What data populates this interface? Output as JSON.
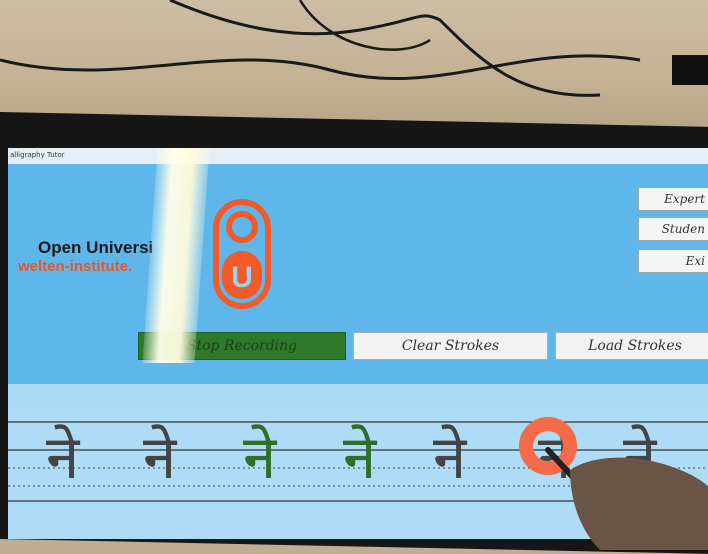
{
  "window": {
    "title": "alligraphy Tutor"
  },
  "header": {
    "org_name": "Open Universi",
    "org_url": "welten-institute.",
    "logo_letter": "U"
  },
  "side_buttons": [
    "Expert",
    "Studen",
    "Exi"
  ],
  "toolbar": {
    "record_label": "Stop Recording",
    "clear_label": "Clear Strokes",
    "load_label": "Load Strokes"
  },
  "colors": {
    "header_blue": "#5fb6ea",
    "accent_orange": "#f15a29",
    "record_green": "#2f7a2a",
    "stroke_green": "#2e6e2a",
    "stroke_red": "#e33b2b"
  },
  "canvas": {
    "glyph": "ने",
    "glyph_count": 7,
    "highlighted_strokes": [
      3,
      4
    ]
  },
  "icons": {
    "cursor": "touch-ring-icon"
  }
}
